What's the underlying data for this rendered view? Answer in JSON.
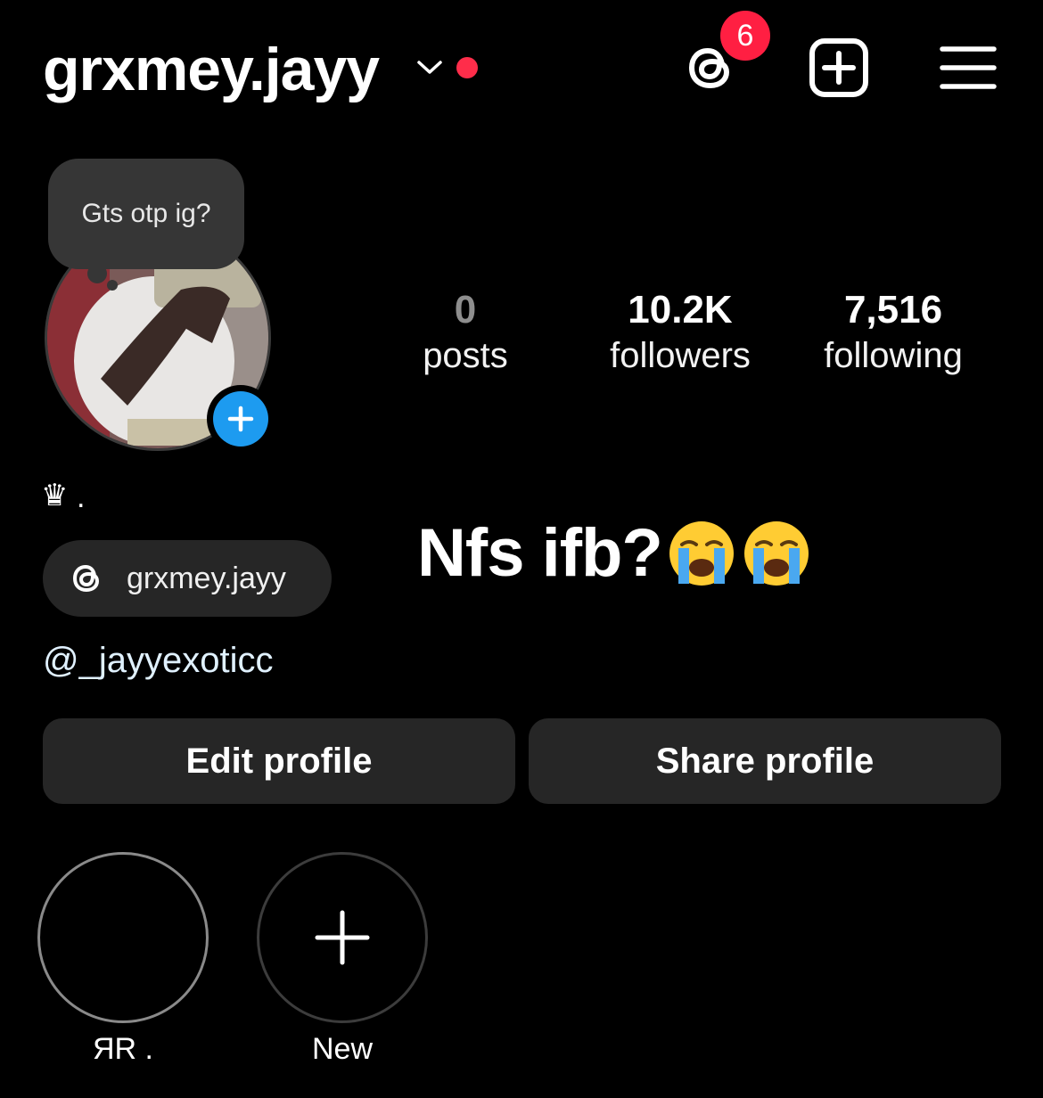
{
  "header": {
    "username": "grxmey.jayy",
    "threads_badge_count": "6",
    "accent_color": "#ff1f42"
  },
  "profile": {
    "note_text": "Gts otp ig?",
    "avatar_icon": "profile-photo",
    "add_story_icon": "plus-icon"
  },
  "stats": {
    "posts": {
      "value": "0",
      "label": "posts"
    },
    "followers": {
      "value": "10.2K",
      "label": "followers"
    },
    "following": {
      "value": "7,516",
      "label": "following"
    }
  },
  "bio": {
    "crown": "♛",
    "crown_suffix": ".",
    "headline": "Nfs ifb?",
    "threads_handle": "grxmey.jayy",
    "mention": "@_jayyexoticc"
  },
  "actions": {
    "edit_label": "Edit profile",
    "share_label": "Share profile"
  },
  "highlights": [
    {
      "label": "ЯR ."
    },
    {
      "label": "New"
    }
  ]
}
